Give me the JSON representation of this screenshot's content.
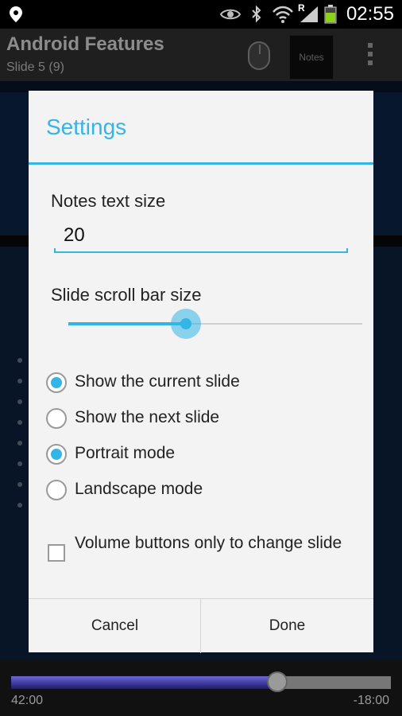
{
  "status_bar": {
    "clock": "02:55",
    "icons": [
      "location-icon",
      "eye-icon",
      "bluetooth-icon",
      "wifi-icon",
      "signal-roaming-icon",
      "battery-icon"
    ],
    "roaming_label": "R"
  },
  "action_bar": {
    "title": "Android Features",
    "subtitle": "Slide 5 (9)",
    "notes_button_label": "Notes"
  },
  "dialog": {
    "title": "Settings",
    "notes_text_size_label": "Notes text size",
    "notes_text_size_value": "20",
    "slide_scroll_bar_label": "Slide scroll bar size",
    "slide_scroll_bar_level": 0.4,
    "options": [
      {
        "label": "Show the current slide",
        "selected": true
      },
      {
        "label": "Show the next slide",
        "selected": false
      },
      {
        "label": "Portrait mode",
        "selected": true
      },
      {
        "label": "Landscape mode",
        "selected": false
      }
    ],
    "volume_checkbox": {
      "label": "Volume buttons only to change slide",
      "checked": false
    },
    "cancel_label": "Cancel",
    "done_label": "Done"
  },
  "playback": {
    "elapsed": "42:00",
    "remaining": "-18:00",
    "progress": 0.7
  },
  "colors": {
    "accent": "#33b5e5",
    "dialog_bg": "#f3f3f3",
    "action_bar_bg": "#3a3a3a"
  }
}
